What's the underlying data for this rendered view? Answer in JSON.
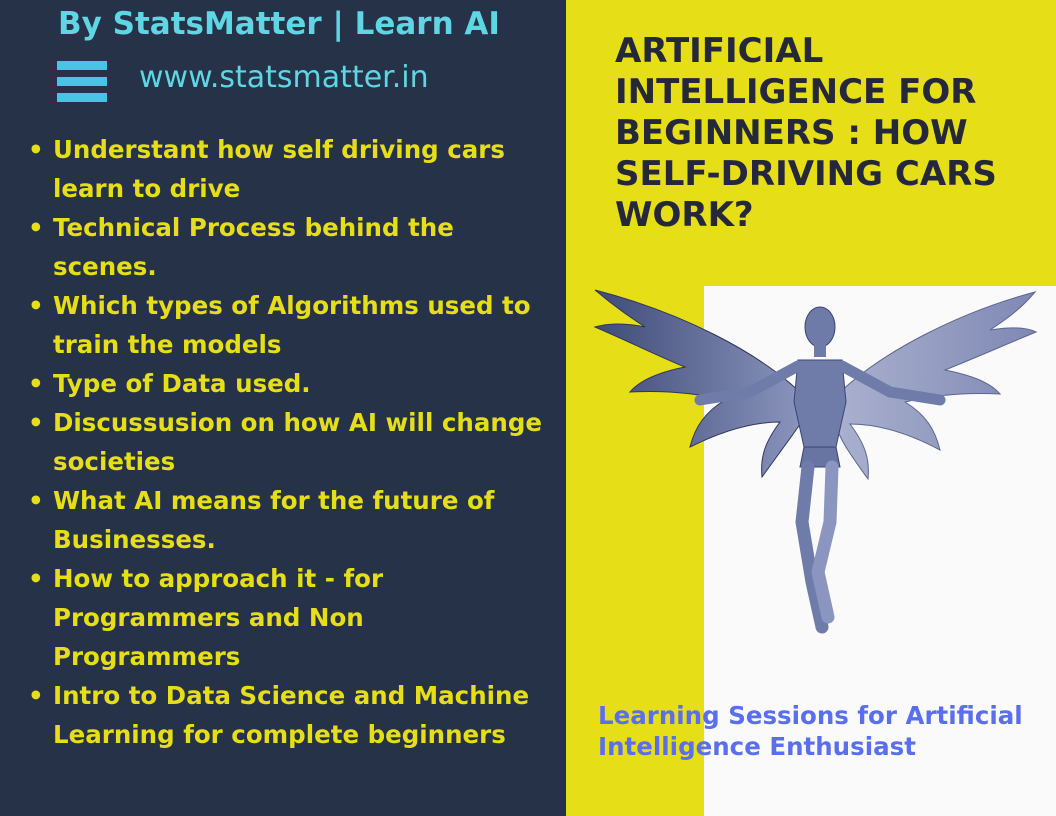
{
  "brand": {
    "title": "By StatsMatter | Learn AI",
    "url": "www.statsmatter.in",
    "menu_icon": "menu-icon"
  },
  "bullets": [
    "Understant how self driving cars learn to drive",
    "Technical Process behind the scenes.",
    "Which types of Algorithms used to train the models",
    "Type of Data used.",
    "Discussusion on how AI will change societies",
    "What AI means for the future of Businesses.",
    "How to approach it - for Programmers and Non Programmers",
    "Intro to Data Science and Machine Learning for complete beginners"
  ],
  "headline": "ARTIFICIAL INTELLIGENCE FOR BEGINNERS : HOW SELF-DRIVING CARS WORK?",
  "tagline": "Learning Sessions for Artificial Intelligence Enthusiast",
  "illustration": "winged-robot-illustration",
  "colors": {
    "left_background": "#263248",
    "right_background": "#e6de16",
    "bullet_text": "#e6de16",
    "brand_text": "#5fd6e4",
    "headline_text": "#24283a",
    "tagline_text": "#5a6ff0"
  }
}
